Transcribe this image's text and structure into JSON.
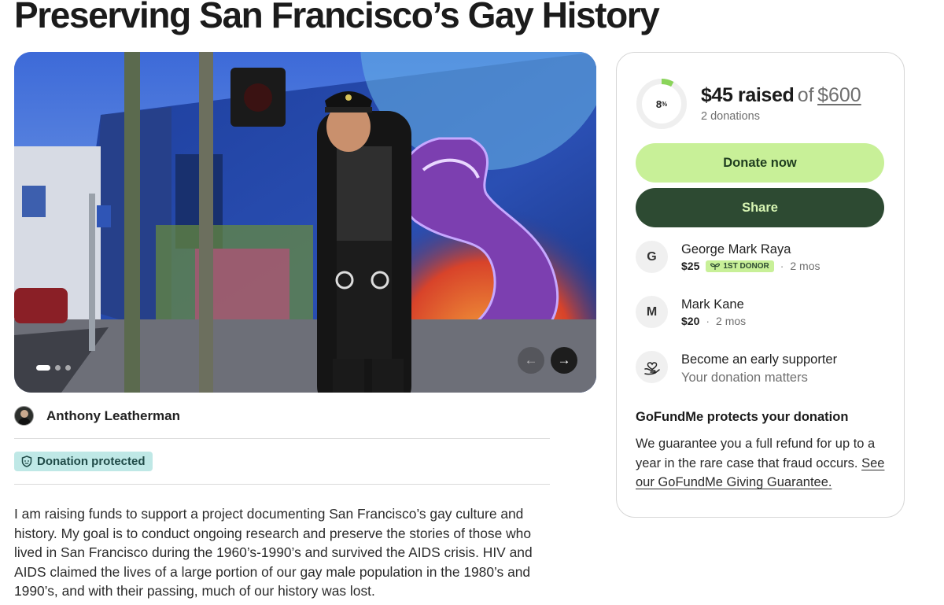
{
  "campaign": {
    "title": "Preserving San Francisco’s Gay History",
    "organizer_name": "Anthony Leatherman",
    "protected_label": "Donation protected",
    "story": "I am raising funds to support a project documenting San Francisco’s gay culture and history. My goal is to conduct ongoing research and preserve the stories of those who lived in San Francisco during the 1960’s-1990’s and survived the AIDS crisis. HIV and AIDS claimed the lives of a large portion of our gay male population in the 1980’s and 1990’s, and with their passing, much of our history was lost."
  },
  "gallery": {
    "slide_count": 3,
    "active_slide": 1,
    "prev_icon": "arrow-left-icon",
    "next_icon": "arrow-right-icon"
  },
  "progress": {
    "percent": 8,
    "percent_suffix": "%",
    "raised_amount": "$45 raised",
    "of_label": "of",
    "goal": "$600",
    "donations_text": "2 donations"
  },
  "actions": {
    "donate_label": "Donate now",
    "share_label": "Share"
  },
  "donors": [
    {
      "initial": "G",
      "name": "George Mark Raya",
      "amount": "$25",
      "badge": "1ST DONOR",
      "time": "2 mos"
    },
    {
      "initial": "M",
      "name": "Mark Kane",
      "amount": "$20",
      "time": "2 mos"
    }
  ],
  "early_supporter": {
    "title": "Become an early supporter",
    "subtitle": "Your donation matters",
    "icon": "heart-hand-icon"
  },
  "guarantee": {
    "title": "GoFundMe protects your donation",
    "text": "We guarantee you a full refund for up to a year in the rare case that fraud occurs.",
    "link": "See our GoFundMe Giving Guarantee."
  },
  "colors": {
    "brand_light_green": "#c8f098",
    "brand_dark_green": "#2d4a32",
    "protected_badge_bg": "#bfe8e6"
  }
}
